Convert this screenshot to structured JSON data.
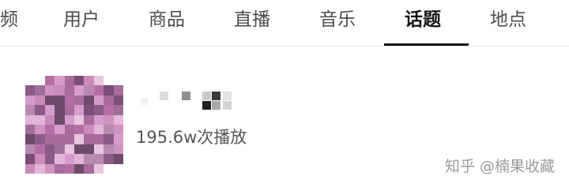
{
  "tabs": [
    {
      "label": "频",
      "active": false
    },
    {
      "label": "用户",
      "active": false
    },
    {
      "label": "商品",
      "active": false
    },
    {
      "label": "直播",
      "active": false
    },
    {
      "label": "音乐",
      "active": false
    },
    {
      "label": "话题",
      "active": true
    },
    {
      "label": "地点",
      "active": false
    }
  ],
  "result": {
    "plays": "195.6w次播放"
  },
  "watermark": {
    "brand": "知乎",
    "author": "@楠果收藏"
  },
  "colors": {
    "active_tab": "#161616",
    "inactive_tab": "#4b4b4b",
    "divider": "#e9e9e9"
  }
}
